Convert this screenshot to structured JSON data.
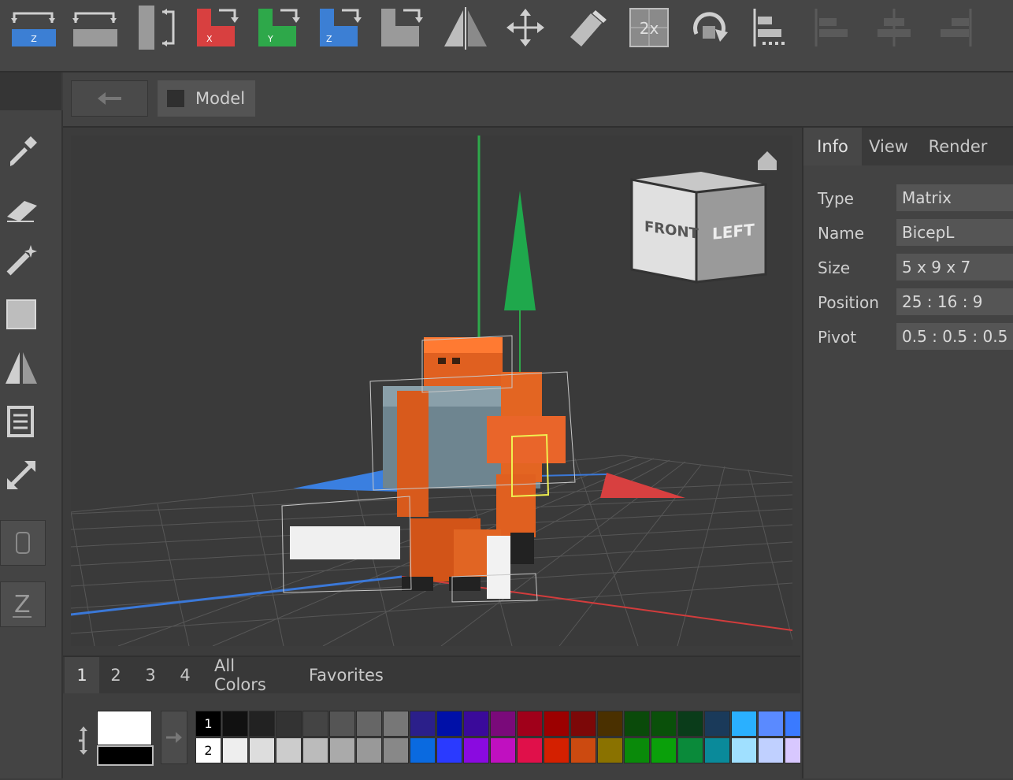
{
  "toolbar": {
    "buttons": [
      {
        "name": "swap-z-button",
        "icon": "swap-z-icon",
        "label": "Z",
        "color": "#3c7fd4"
      },
      {
        "name": "swap-button",
        "icon": "swap-icon",
        "label": "",
        "color": "#9a9a9a"
      },
      {
        "name": "flip-vertical-button",
        "icon": "flip-bar-icon",
        "label": "",
        "color": "#9a9a9a"
      },
      {
        "name": "rotate-x-button",
        "icon": "rotate-x-icon",
        "label": "X",
        "color": "#d84040"
      },
      {
        "name": "rotate-y-button",
        "icon": "rotate-y-icon",
        "label": "Y",
        "color": "#2ea84a"
      },
      {
        "name": "rotate-z-button",
        "icon": "rotate-z-icon",
        "label": "Z",
        "color": "#3c7fd4"
      },
      {
        "name": "rotate-button",
        "icon": "rotate-l-icon",
        "label": "",
        "color": "#9a9a9a"
      },
      {
        "name": "mirror-button",
        "icon": "mirror-icon"
      },
      {
        "name": "move-button",
        "icon": "move-icon"
      },
      {
        "name": "pen-ruler-button",
        "icon": "pen-icon"
      },
      {
        "name": "scale-2x-button",
        "icon": "scale-2x-icon",
        "label": "2x"
      },
      {
        "name": "rotate-snap-button",
        "icon": "rotate-arrow-icon"
      },
      {
        "name": "align-left-bottom-button",
        "icon": "align-left-icon"
      },
      {
        "name": "align-left-button",
        "icon": "align-bars-icon"
      },
      {
        "name": "align-center-button",
        "icon": "align-center-icon"
      },
      {
        "name": "align-right-button",
        "icon": "align-right-icon"
      }
    ]
  },
  "nav": {
    "breadcrumb": "Model"
  },
  "right_panel": {
    "tabs": [
      "Info",
      "View",
      "Render"
    ],
    "active_tab": "Info",
    "props": [
      {
        "label": "Type",
        "value": "Matrix"
      },
      {
        "label": "Name",
        "value": "BicepL"
      },
      {
        "label": "Size",
        "value": "5 x 9 x 7"
      },
      {
        "label": "Position",
        "value": "25 : 16 : 9"
      },
      {
        "label": "Pivot",
        "value": "0.5 : 0.5 : 0.5"
      }
    ]
  },
  "viewcube": {
    "front": "FRONT",
    "left": "LEFT"
  },
  "palette": {
    "tabs": [
      "1",
      "2",
      "3",
      "4",
      "All Colors",
      "Favorites"
    ],
    "active_tab": "1",
    "primary_color": "#ffffff",
    "secondary_color": "#000000",
    "row1_label": "1",
    "row2_label": "2",
    "row1": [
      "#000000",
      "#111111",
      "#222222",
      "#333333",
      "#444444",
      "#555555",
      "#666666",
      "#777777",
      "#2b1f8a",
      "#0010a8",
      "#3a0a9a",
      "#7a0a7a",
      "#a0001a",
      "#9c0000",
      "#7c0808",
      "#4a3000",
      "#0a4a0a",
      "#0a500a",
      "#0a3c1a",
      "#1a3a5a",
      "#2ab0ff",
      "#5a8aff",
      "#3a7aff"
    ],
    "row2": [
      "#ffffff",
      "#eeeeee",
      "#dddddd",
      "#cccccc",
      "#bbbbbb",
      "#aaaaaa",
      "#999999",
      "#888888",
      "#0a6ae0",
      "#2a3aff",
      "#8a0ae0",
      "#c010c0",
      "#e0104a",
      "#d42000",
      "#cc4a10",
      "#8a7200",
      "#0a8a0a",
      "#0aa00a",
      "#0a8a3a",
      "#0a8a9a",
      "#a0e0ff",
      "#c0d0ff",
      "#d8c8ff"
    ]
  },
  "left_tools": [
    {
      "name": "eyedropper-tool",
      "icon": "eyedropper-icon"
    },
    {
      "name": "eraser-tool",
      "icon": "eraser-icon"
    },
    {
      "name": "magic-wand-tool",
      "icon": "magic-wand-icon"
    },
    {
      "name": "box-tool",
      "icon": "square-icon"
    },
    {
      "name": "mirror-tool",
      "icon": "mirror-icon"
    },
    {
      "name": "layers-tool",
      "icon": "layers-icon"
    },
    {
      "name": "resize-tool",
      "icon": "resize-icon"
    }
  ]
}
